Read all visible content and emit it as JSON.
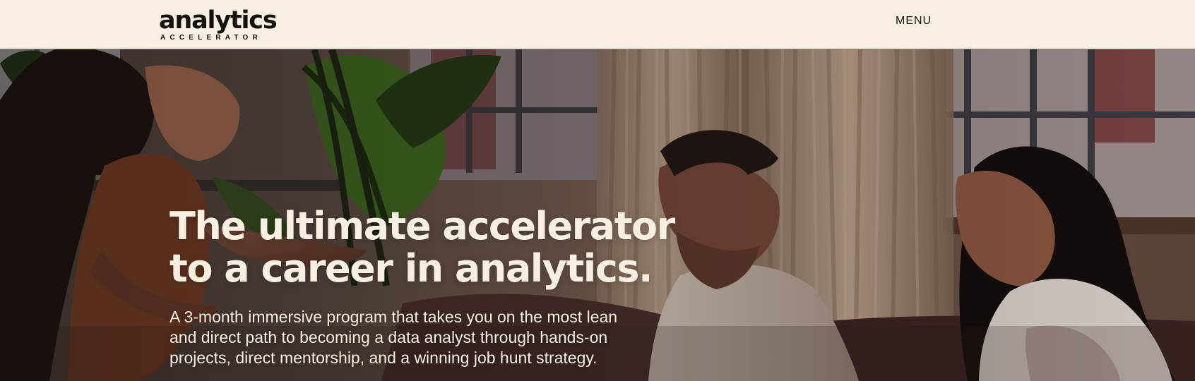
{
  "header": {
    "logo": {
      "wordmark": "analytics",
      "subtitle": "ACCELERATOR"
    },
    "menu_label": "MENU"
  },
  "hero": {
    "headline_lines": [
      "The ultimate accelerator",
      "to a career in analytics."
    ],
    "description_lines": [
      "A 3-month immersive program that takes you on the most lean",
      "and direct path to becoming a data analyst through hands-on",
      "projects, direct mentorship, and a winning job hunt strategy."
    ],
    "colors": {
      "background": "#f7efe2",
      "text_dark": "#15120f",
      "text_light": "#f7efe2"
    }
  }
}
